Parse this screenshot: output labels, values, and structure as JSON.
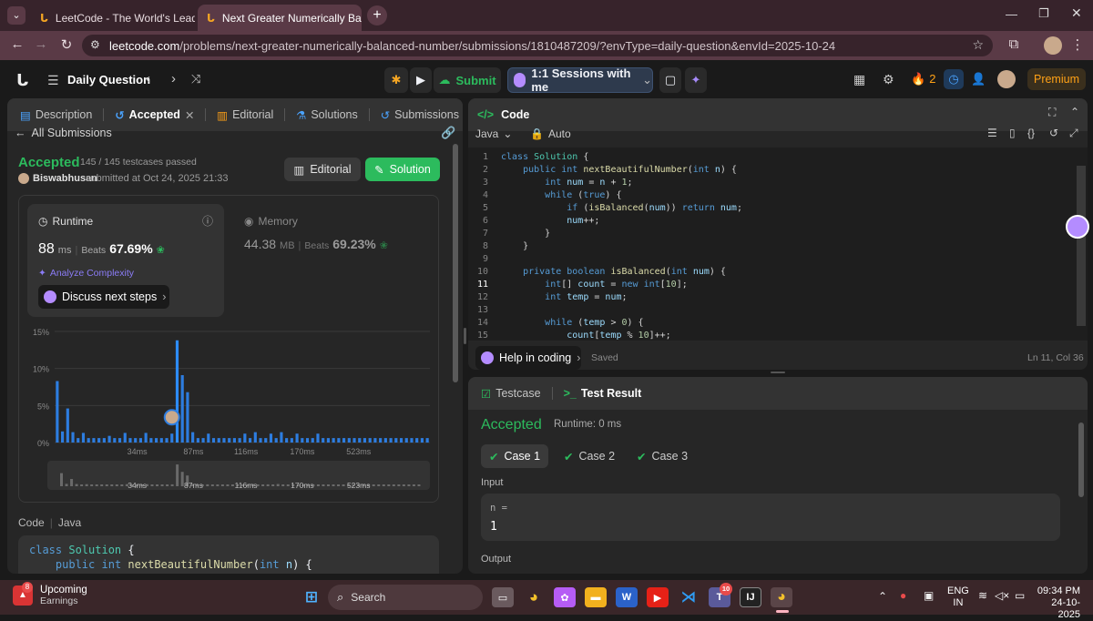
{
  "browser": {
    "tabs": [
      {
        "title": "LeetCode - The World's Leading"
      },
      {
        "title": "Next Greater Numerically Balan"
      }
    ],
    "new_tab": "+",
    "url_host": "leetcode.com",
    "url_path": "/problems/next-greater-numerically-balanced-number/submissions/1810487209/?envType=daily-question&envId=2025-10-24"
  },
  "header": {
    "title": "Daily Question",
    "submit": "Submit",
    "sessions": "1:1 Sessions with me",
    "streak": "2",
    "premium": "Premium"
  },
  "left": {
    "tabs": [
      "Description",
      "Accepted",
      "Editorial",
      "Solutions",
      "Submissions"
    ],
    "back": "All Submissions",
    "status": "Accepted",
    "testcases": "145 / 145 testcases passed",
    "user": "Biswabhusan",
    "submitted": "submitted at Oct 24, 2025 21:33",
    "editorial_btn": "Editorial",
    "solution_btn": "Solution",
    "runtime": {
      "label": "Runtime",
      "value": "88",
      "unit": "ms",
      "beats_label": "Beats",
      "beats": "67.69%"
    },
    "memory": {
      "label": "Memory",
      "value": "44.38",
      "unit": "MB",
      "beats_label": "Beats",
      "beats": "69.23%"
    },
    "analyze": "Analyze Complexity",
    "discuss": "Discuss next steps",
    "code_label": "Code",
    "lang": "Java",
    "code_preview": [
      "class Solution {",
      "    public int nextBeautifulNumber(int n) {"
    ]
  },
  "chart_data": {
    "type": "bar",
    "y_ticks": [
      "15%",
      "10%",
      "5%",
      "0%"
    ],
    "x_ticks": [
      "34ms",
      "87ms",
      "116ms",
      "170ms",
      "523ms"
    ],
    "ylim": [
      0,
      15
    ],
    "highlight_index": 22,
    "values": [
      8.3,
      1.5,
      4.6,
      1.4,
      0.6,
      1.3,
      0.6,
      0.6,
      0.6,
      0.6,
      0.9,
      0.6,
      0.6,
      1.3,
      0.6,
      0.6,
      0.6,
      1.3,
      0.6,
      0.6,
      0.6,
      0.6,
      1.2,
      13.8,
      9.1,
      6.8,
      1.4,
      0.6,
      0.6,
      1.2,
      0.6,
      0.6,
      0.6,
      0.6,
      0.6,
      0.6,
      1.2,
      0.6,
      1.4,
      0.6,
      0.6,
      1.2,
      0.6,
      1.4,
      0.6,
      0.6,
      1.2,
      0.6,
      0.6,
      0.6,
      1.2,
      0.6,
      0.6,
      0.6,
      0.6,
      0.6,
      0.6,
      0.6,
      0.6,
      0.6,
      0.6,
      0.6,
      0.6,
      0.6,
      0.6,
      0.6,
      0.6,
      0.6,
      0.6,
      0.6,
      0.6,
      0.6
    ],
    "mini_x_ticks": [
      "34ms",
      "87ms",
      "116ms",
      "170ms",
      "523ms"
    ]
  },
  "editor": {
    "title": "Code",
    "lang": "Java",
    "mode": "Auto",
    "cursor": "Ln 11, Col 36",
    "saved": "Saved",
    "help": "Help in coding"
  },
  "test": {
    "tab1": "Testcase",
    "tab2": "Test Result",
    "status": "Accepted",
    "runtime": "Runtime: 0 ms",
    "cases": [
      "Case 1",
      "Case 2",
      "Case 3"
    ],
    "input_label": "Input",
    "input_name": "n =",
    "input_value": "1",
    "output_label": "Output"
  },
  "taskbar": {
    "weather_title": "Upcoming",
    "weather_sub": "Earnings",
    "search": "Search",
    "lang": "ENG",
    "region": "IN",
    "time": "09:34 PM",
    "date": "24-10-2025",
    "badge_weather": "8",
    "badge_teams": "10"
  }
}
